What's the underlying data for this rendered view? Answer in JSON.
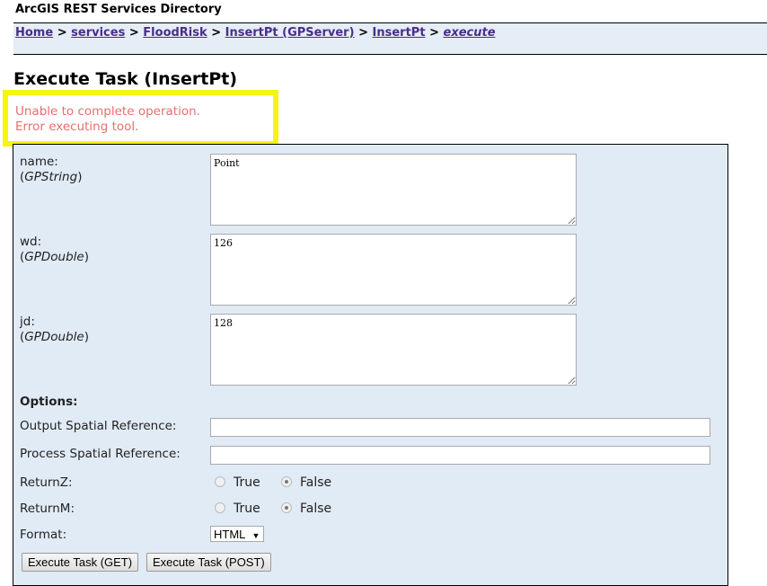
{
  "app_title": "ArcGIS REST Services Directory",
  "breadcrumb": [
    {
      "label": "Home"
    },
    {
      "label": "services"
    },
    {
      "label": "FloodRisk"
    },
    {
      "label": "InsertPt (GPServer)"
    },
    {
      "label": "InsertPt"
    },
    {
      "label": "execute"
    }
  ],
  "breadcrumb_sep": ">",
  "page_title": "Execute Task (InsertPt)",
  "error": {
    "line1": "Unable to complete operation.",
    "line2": "Error executing tool.",
    "highlight_color": "#f5f510"
  },
  "params": [
    {
      "name": "name:",
      "type": "GPString",
      "value": "Point"
    },
    {
      "name": "wd:",
      "type": "GPDouble",
      "value": "126"
    },
    {
      "name": "jd:",
      "type": "GPDouble",
      "value": "128"
    }
  ],
  "options": {
    "heading": "Options:",
    "out_sr_label": "Output Spatial Reference:",
    "out_sr_value": "",
    "proc_sr_label": "Process Spatial Reference:",
    "proc_sr_value": "",
    "returnz_label": "ReturnZ:",
    "returnm_label": "ReturnM:",
    "true_label": "True",
    "false_label": "False",
    "returnz_value": "False",
    "returnm_value": "False",
    "format_label": "Format:",
    "format_value": "HTML"
  },
  "buttons": {
    "get": "Execute Task (GET)",
    "post": "Execute Task (POST)"
  }
}
